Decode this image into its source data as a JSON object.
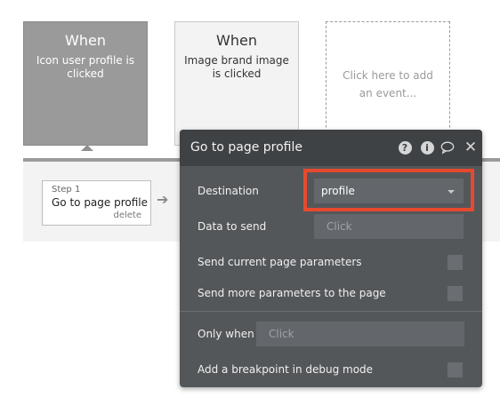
{
  "events": [
    {
      "title": "When",
      "subtitle": "Icon user profile is clicked"
    },
    {
      "title": "When",
      "subtitle": "Image brand image is clicked"
    },
    {
      "add_text": "Click here to add an event..."
    }
  ],
  "step": {
    "number": "Step 1",
    "name": "Go to page profile",
    "delete_label": "delete"
  },
  "panel": {
    "title": "Go to page profile",
    "icons": [
      "help-icon",
      "info-icon",
      "comment-icon",
      "close-icon"
    ],
    "destination_label": "Destination",
    "destination_value": "profile",
    "data_to_send_label": "Data to send",
    "data_to_send_placeholder": "Click",
    "send_current_params_label": "Send current page parameters",
    "send_more_params_label": "Send more parameters to the page",
    "only_when_label": "Only when",
    "only_when_placeholder": "Click",
    "breakpoint_label": "Add a breakpoint in debug mode"
  },
  "colors": {
    "highlight": "#e64a2e",
    "panel_bg": "#54575a",
    "panel_header": "#3f4245"
  }
}
